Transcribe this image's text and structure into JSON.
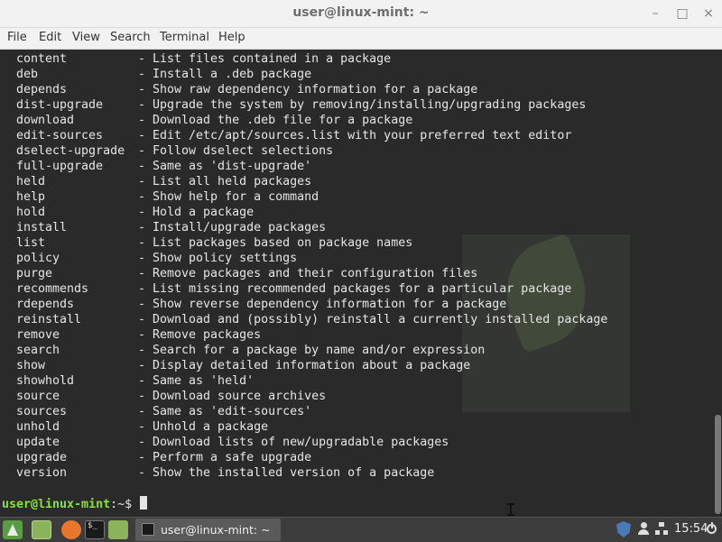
{
  "window": {
    "title": "user@linux-mint: ~",
    "controls": {
      "minimize": "–",
      "maximize": "□",
      "close": "×"
    }
  },
  "menu": [
    "File",
    "Edit",
    "View",
    "Search",
    "Terminal",
    "Help"
  ],
  "terminal": {
    "lines": [
      {
        "cmd": "content",
        "desc": "- List files contained in a package"
      },
      {
        "cmd": "deb",
        "desc": "- Install a .deb package"
      },
      {
        "cmd": "depends",
        "desc": "- Show raw dependency information for a package"
      },
      {
        "cmd": "dist-upgrade",
        "desc": "- Upgrade the system by removing/installing/upgrading packages"
      },
      {
        "cmd": "download",
        "desc": "- Download the .deb file for a package"
      },
      {
        "cmd": "edit-sources",
        "desc": "- Edit /etc/apt/sources.list with your preferred text editor"
      },
      {
        "cmd": "dselect-upgrade",
        "desc": "- Follow dselect selections"
      },
      {
        "cmd": "full-upgrade",
        "desc": "- Same as 'dist-upgrade'"
      },
      {
        "cmd": "held",
        "desc": "- List all held packages"
      },
      {
        "cmd": "help",
        "desc": "- Show help for a command"
      },
      {
        "cmd": "hold",
        "desc": "- Hold a package"
      },
      {
        "cmd": "install",
        "desc": "- Install/upgrade packages"
      },
      {
        "cmd": "list",
        "desc": "- List packages based on package names"
      },
      {
        "cmd": "policy",
        "desc": "- Show policy settings"
      },
      {
        "cmd": "purge",
        "desc": "- Remove packages and their configuration files"
      },
      {
        "cmd": "recommends",
        "desc": "- List missing recommended packages for a particular package"
      },
      {
        "cmd": "rdepends",
        "desc": "- Show reverse dependency information for a package"
      },
      {
        "cmd": "reinstall",
        "desc": "- Download and (possibly) reinstall a currently installed package"
      },
      {
        "cmd": "remove",
        "desc": "- Remove packages"
      },
      {
        "cmd": "search",
        "desc": "- Search for a package by name and/or expression"
      },
      {
        "cmd": "show",
        "desc": "- Display detailed information about a package"
      },
      {
        "cmd": "showhold",
        "desc": "- Same as 'held'"
      },
      {
        "cmd": "source",
        "desc": "- Download source archives"
      },
      {
        "cmd": "sources",
        "desc": "- Same as 'edit-sources'"
      },
      {
        "cmd": "unhold",
        "desc": "- Unhold a package"
      },
      {
        "cmd": "update",
        "desc": "- Download lists of new/upgradable packages"
      },
      {
        "cmd": "upgrade",
        "desc": "- Perform a safe upgrade"
      },
      {
        "cmd": "version",
        "desc": "- Show the installed version of a package"
      }
    ],
    "prompt_user": "user@linux-mint",
    "prompt_tail": ":~$ ",
    "colors": {
      "background": "#2a2a2a",
      "text": "#e6e6e6",
      "prompt": "#8ae234"
    }
  },
  "taskbar": {
    "launchers": [
      "mint-menu-icon",
      "show-desktop-icon",
      "firefox-icon",
      "terminal-icon",
      "files-icon"
    ],
    "terminal_glyph": "$_",
    "active_task": "user@linux-mint: ~",
    "clock": "15:54"
  }
}
